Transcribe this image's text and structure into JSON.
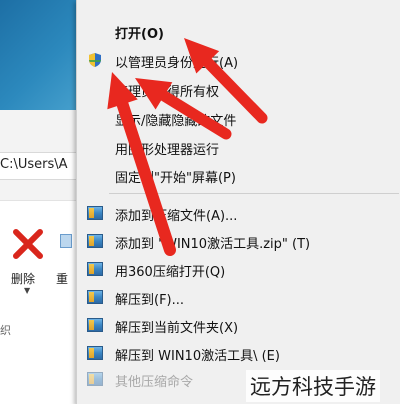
{
  "explorer": {
    "address_fragment": "C:\\Users\\A",
    "ribbon": {
      "delete_label": "删除",
      "rename_label": "重",
      "group_label": "织"
    }
  },
  "context_menu": {
    "items": [
      {
        "label": "打开(O)",
        "bold": true
      },
      {
        "label": "以管理员身份运行(A)",
        "icon": "uac-shield-icon"
      },
      {
        "label": "管理员取得所有权"
      },
      {
        "label": "显示/隐藏隐藏的文件"
      },
      {
        "label": "用图形处理器运行"
      },
      {
        "label": "固定到\"开始\"屏幕(P)"
      },
      {
        "label": "添加到压缩文件(A)...",
        "icon": "archive-icon"
      },
      {
        "label": "添加到 \"WIN10激活工具.zip\" (T)",
        "icon": "archive-icon"
      },
      {
        "label": "用360压缩打开(Q)",
        "icon": "archive-icon"
      },
      {
        "label": "解压到(F)...",
        "icon": "archive-icon"
      },
      {
        "label": "解压到当前文件夹(X)",
        "icon": "archive-icon"
      },
      {
        "label": "解压到 WIN10激活工具\\ (E)",
        "icon": "archive-icon"
      },
      {
        "label": "其他压缩命令",
        "icon": "archive-icon",
        "disabled": true
      }
    ]
  },
  "annotation": {
    "arrow_color": "#e8281f"
  },
  "watermark": "远方科技手游"
}
